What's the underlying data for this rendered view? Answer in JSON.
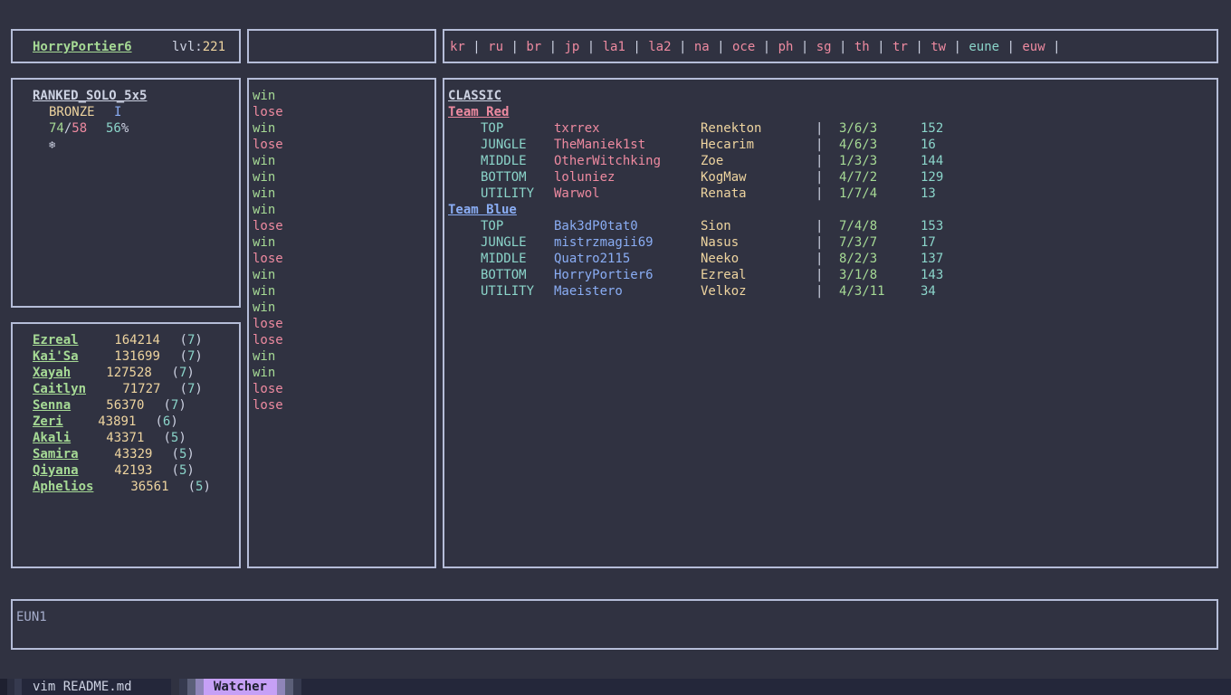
{
  "user": {
    "name": "HorryPortier6",
    "level_label": "lvl:",
    "level": "221"
  },
  "regions": [
    "kr",
    "ru",
    "br",
    "jp",
    "la1",
    "la2",
    "na",
    "oce",
    "ph",
    "sg",
    "th",
    "tr",
    "tw",
    "eune",
    "euw"
  ],
  "rank": {
    "queue": "RANKED_SOLO_5x5",
    "tier": "BRONZE",
    "division": "I",
    "wins": "74",
    "losses": "58",
    "winrate": "56",
    "pct": "%",
    "icon": "❄"
  },
  "champions": [
    {
      "name": "Ezreal",
      "points": "164214",
      "level": "7"
    },
    {
      "name": "Kai'Sa",
      "points": "131699",
      "level": "7"
    },
    {
      "name": "Xayah",
      "points": "127528",
      "level": "7"
    },
    {
      "name": "Caitlyn",
      "points": "71727",
      "level": "7"
    },
    {
      "name": "Senna",
      "points": "56370",
      "level": "7"
    },
    {
      "name": "Zeri",
      "points": "43891",
      "level": "6"
    },
    {
      "name": "Akali",
      "points": "43371",
      "level": "5"
    },
    {
      "name": "Samira",
      "points": "43329",
      "level": "5"
    },
    {
      "name": "Qiyana",
      "points": "42193",
      "level": "5"
    },
    {
      "name": "Aphelios",
      "points": "36561",
      "level": "5"
    }
  ],
  "history": [
    "win",
    "lose",
    "win",
    "lose",
    "win",
    "win",
    "win",
    "win",
    "lose",
    "win",
    "lose",
    "win",
    "win",
    "win",
    "lose",
    "lose",
    "win",
    "win",
    "lose",
    "lose"
  ],
  "match": {
    "mode": "CLASSIC",
    "teams": [
      {
        "name": "Team Red",
        "color": "red",
        "players": [
          {
            "role": "TOP",
            "summoner": "txrrex",
            "champion": "Renekton",
            "kda": "3/6/3",
            "cs": "152"
          },
          {
            "role": "JUNGLE",
            "summoner": "TheManiek1st",
            "champion": "Hecarim",
            "kda": "4/6/3",
            "cs": "16"
          },
          {
            "role": "MIDDLE",
            "summoner": "OtherWitchking",
            "champion": "Zoe",
            "kda": "1/3/3",
            "cs": "144"
          },
          {
            "role": "BOTTOM",
            "summoner": "loluniez",
            "champion": "KogMaw",
            "kda": "4/7/2",
            "cs": "129"
          },
          {
            "role": "UTILITY",
            "summoner": "Warwol",
            "champion": "Renata",
            "kda": "1/7/4",
            "cs": "13"
          }
        ]
      },
      {
        "name": "Team Blue",
        "color": "blue",
        "players": [
          {
            "role": "TOP",
            "summoner": "Bak3dP0tat0",
            "champion": "Sion",
            "kda": "7/4/8",
            "cs": "153"
          },
          {
            "role": "JUNGLE",
            "summoner": "mistrzmagii69",
            "champion": "Nasus",
            "kda": "7/3/7",
            "cs": "17"
          },
          {
            "role": "MIDDLE",
            "summoner": "Quatro2115",
            "champion": "Neeko",
            "kda": "8/2/3",
            "cs": "137"
          },
          {
            "role": "BOTTOM",
            "summoner": "HorryPortier6",
            "champion": "Ezreal",
            "kda": "3/1/8",
            "cs": "143"
          },
          {
            "role": "UTILITY",
            "summoner": "Maeistero",
            "champion": "Velkoz",
            "kda": "4/3/11",
            "cs": "34"
          }
        ]
      }
    ],
    "separator": "|"
  },
  "command": {
    "text": "EUN1"
  },
  "statusbar": {
    "left": "vim README.md",
    "active": "Watcher"
  }
}
